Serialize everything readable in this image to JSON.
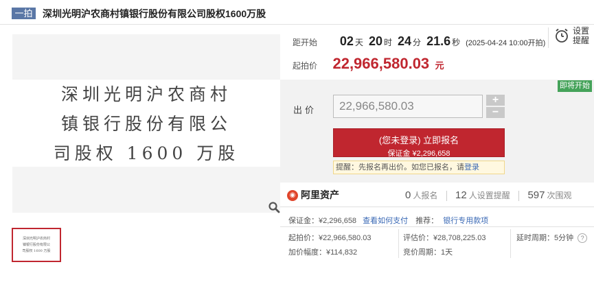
{
  "header": {
    "tag": "一拍",
    "title": "深圳光明沪农商村镇银行股份有限公司股权1600万股"
  },
  "preview": {
    "lines": [
      "深圳光明沪农商村",
      "镇银行股份有限公",
      "司股权 1600 万股"
    ],
    "zoom_icon": "magnifier-icon"
  },
  "countdown": {
    "label": "距开始",
    "days": "02",
    "days_unit": "天",
    "hours": "20",
    "hours_unit": "时",
    "minutes": "24",
    "minutes_unit": "分",
    "seconds": "21.6",
    "seconds_unit": "秒",
    "start_note": "(2025-04-24 10:00开拍)"
  },
  "setting": {
    "label_line1": "设置",
    "label_line2": "提醒",
    "icon": "alarm-clock-icon"
  },
  "start_price": {
    "label": "起拍价",
    "value": "22,966,580.03",
    "unit": "元"
  },
  "bid": {
    "status_badge": "即将开始",
    "label": "出价",
    "input_value": "22,966,580.03",
    "plus": "+",
    "minus": "−",
    "signup_line1": "(您未登录) 立即报名",
    "signup_line2": "保证金 ¥2,296,658",
    "tip_text": "提醒：先报名再出价。如您已报名，请",
    "tip_link": "登录"
  },
  "platform": {
    "name": "阿里资产",
    "logo_icon": "ali-asset-logo-icon"
  },
  "stats": {
    "signups": "0",
    "signups_label": "人报名",
    "reminders": "12",
    "reminders_label": "人设置提醒",
    "views": "597",
    "views_label": "次围观"
  },
  "details": {
    "deposit_label": "保证金：¥2,296,658",
    "how_to_pay": "查看如何支付",
    "recommend_label": "推荐：",
    "bank_link": "银行专用款项",
    "start_price": "起拍价：¥22,966,580.03",
    "increment": "加价幅度：¥114,832",
    "appraisal": "评估价：¥28,708,225.03",
    "bid_cycle": "竞价周期：1天",
    "delay_cycle": "延时周期：5分钟",
    "help_icon": "question-icon"
  },
  "colors": {
    "accent_red": "#c0262f",
    "tag_blue": "#5a77a6",
    "badge_green": "#45a35a",
    "link_blue": "#3a69b5"
  }
}
